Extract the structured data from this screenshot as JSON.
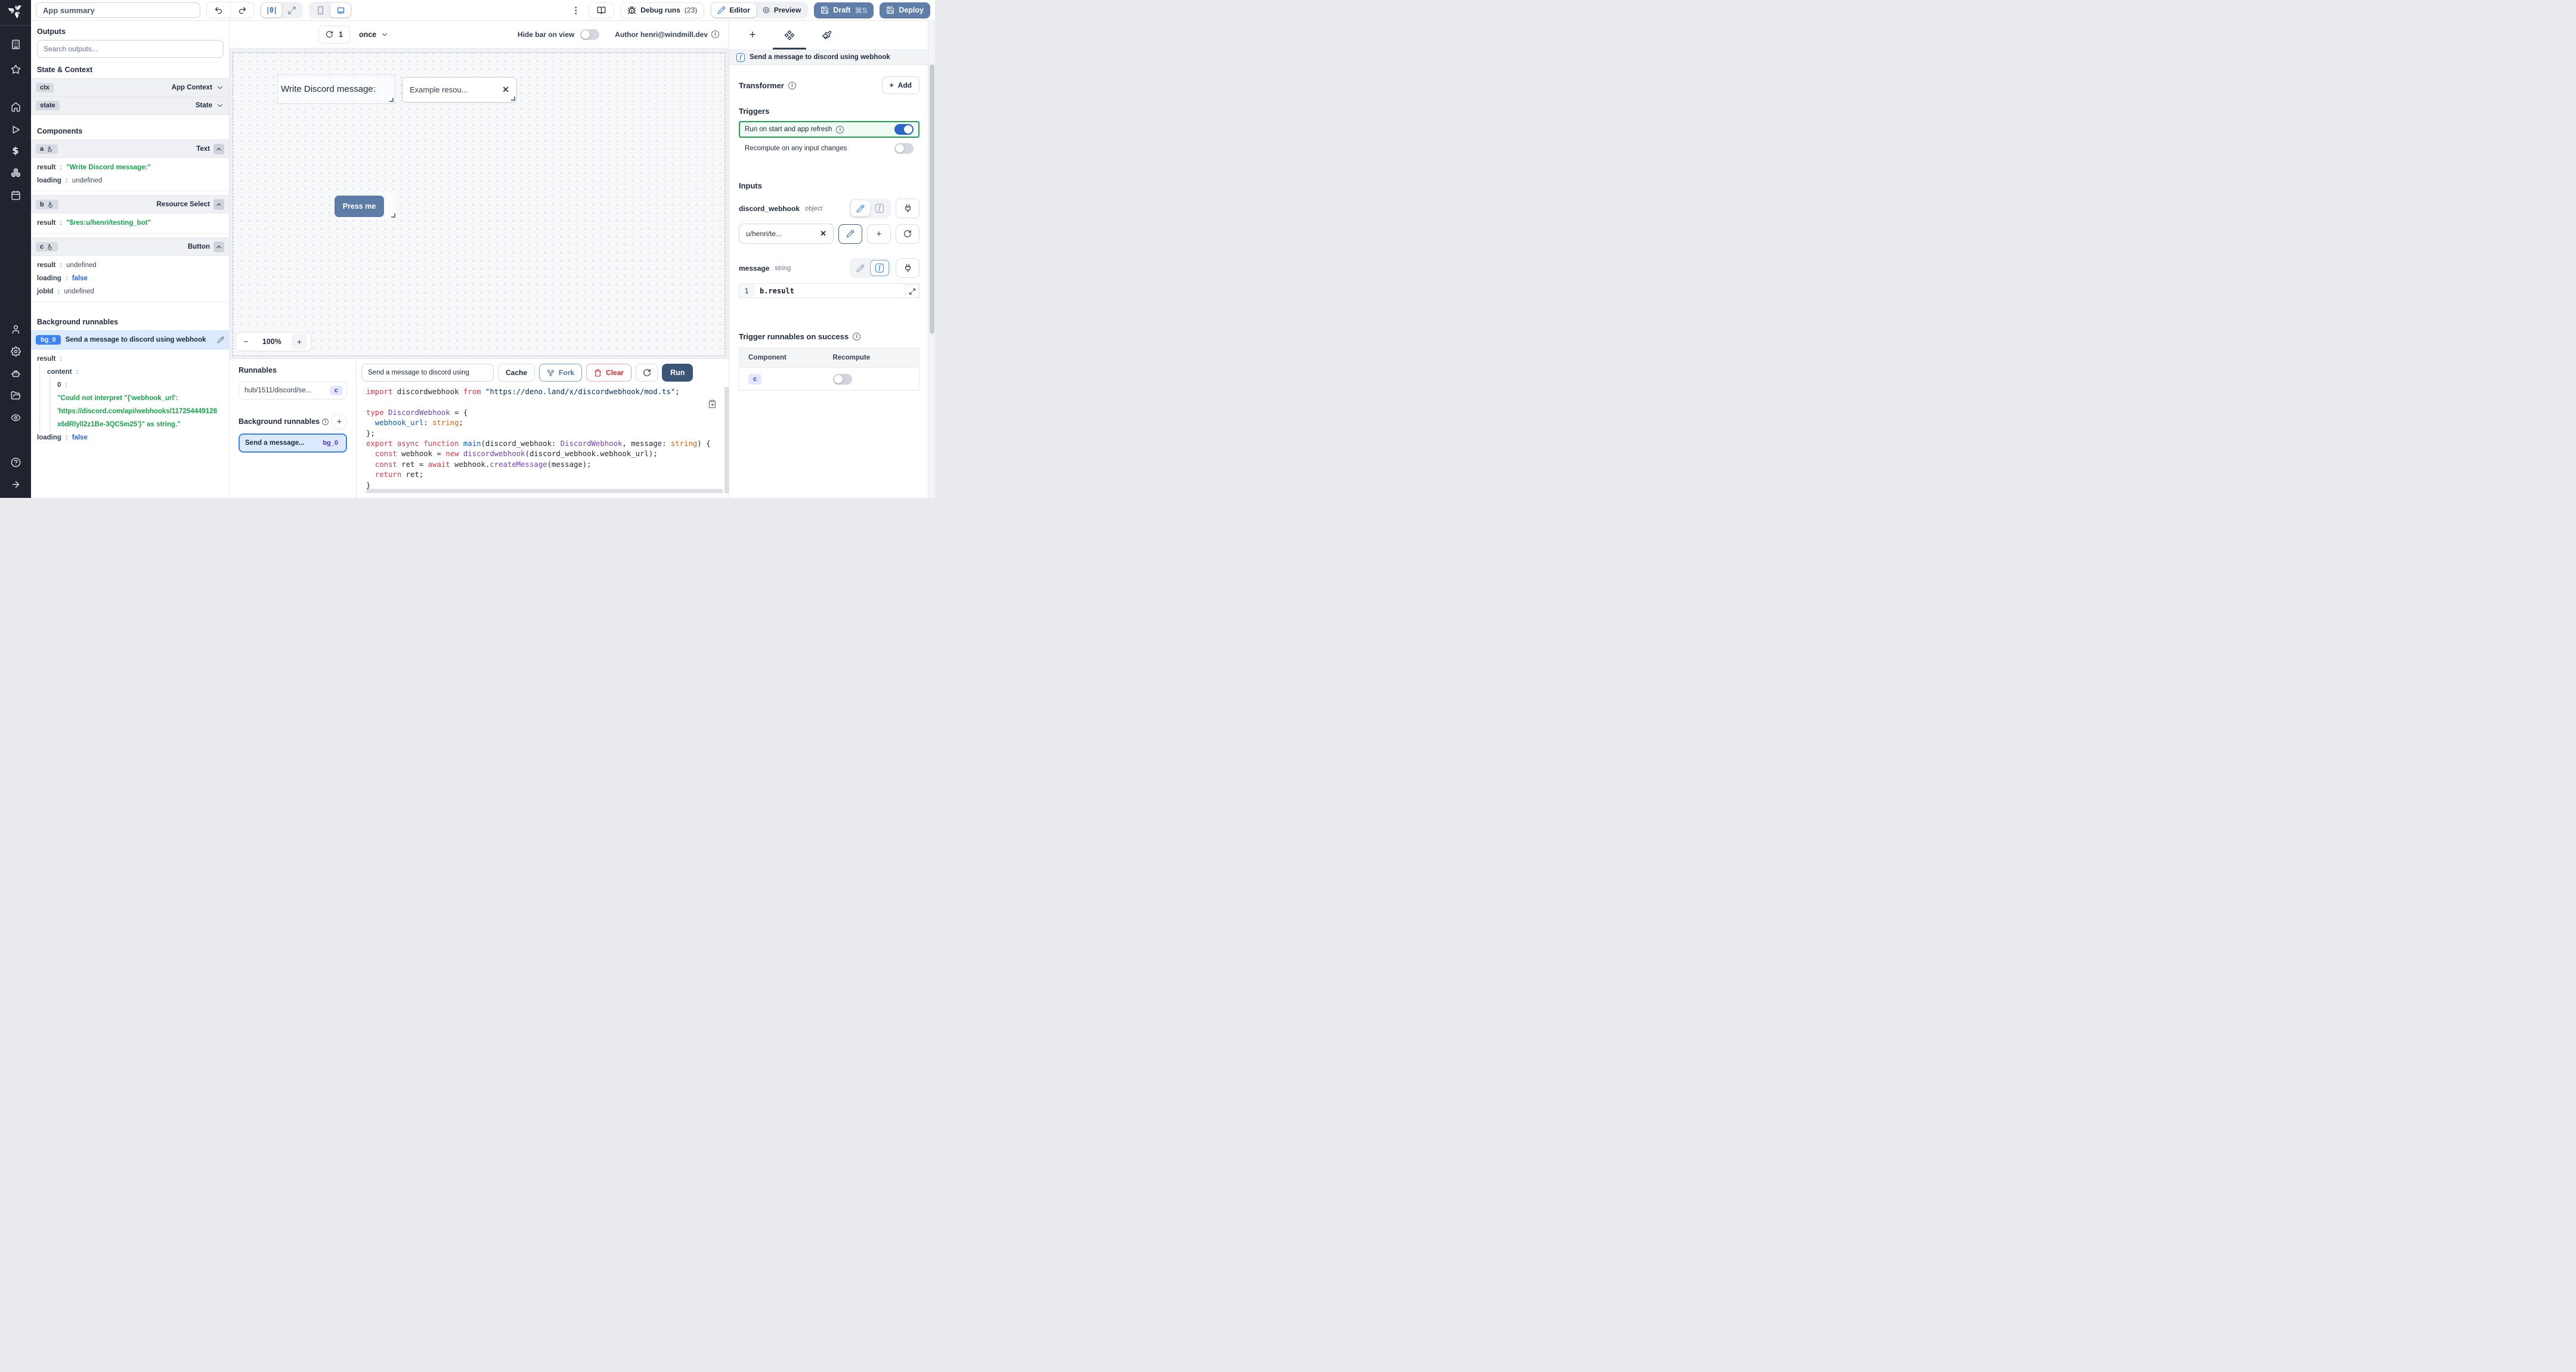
{
  "icons_glyphs": {
    "info": "i",
    "close": "✕",
    "plus": "+",
    "minus": "−",
    "kebab": "⋮",
    "dollar": "$",
    "center_align": "|0|",
    "fn": "f"
  },
  "topbar": {
    "app_summary": "App summary",
    "debug_runs_label": "Debug runs",
    "debug_runs_count": "(23)",
    "editor_label": "Editor",
    "preview_label": "Preview",
    "draft_label": "Draft",
    "draft_shortcut": "⌘S",
    "deploy_label": "Deploy"
  },
  "sidebar": {
    "icon_names": [
      "windmill-logo",
      "building",
      "star",
      "home",
      "play",
      "dollar",
      "boxes",
      "calendar",
      "user",
      "settings",
      "bot",
      "folder-open",
      "eye",
      "help",
      "arrow-right"
    ]
  },
  "outputs_panel": {
    "title": "Outputs",
    "search_placeholder": "Search outputs...",
    "state_context_title": "State & Context",
    "ctx_badge": "ctx",
    "ctx_label": "App Context",
    "state_badge": "state",
    "state_label": "State",
    "components_title": "Components",
    "comp_a": {
      "id": "a",
      "type": "Text",
      "rows": [
        {
          "k": "result",
          "v": "\"Write Discord message:\""
        },
        {
          "k": "loading",
          "v": "undefined"
        }
      ]
    },
    "comp_b": {
      "id": "b",
      "type": "Resource Select",
      "rows": [
        {
          "k": "result",
          "v": "\"$res:u/henri/testing_bot\""
        }
      ]
    },
    "comp_c": {
      "id": "c",
      "type": "Button",
      "rows": [
        {
          "k": "result",
          "v": "undefined"
        },
        {
          "k": "loading",
          "v": "false"
        },
        {
          "k": "jobId",
          "v": "undefined"
        }
      ]
    },
    "background_title": "Background runnables",
    "bg": {
      "badge": "bg_0",
      "name": "Send a message to discord using webhook",
      "result_key": "result",
      "content_key": "content",
      "zero_key": "0",
      "line1": "\"Could not interpret \"{'webhook_url':",
      "line2": "'https://discord.com/api/webhooks/117254449128",
      "line3": "x6dRlyll2z1Be-3QC5m25'}\" as string.\"",
      "loading_key": "loading",
      "loading_val": "false"
    }
  },
  "canvas": {
    "refresh_count": "1",
    "frequency": "once",
    "hide_bar_label": "Hide bar on view",
    "author_label": "Author henri@windmill.dev",
    "zoom_level": "100%",
    "text_component": "Write Discord message:",
    "select_value": "Example resou...",
    "button_label": "Press me"
  },
  "runnables_panel": {
    "title": "Runnables",
    "item_path": "hub/1511/discord/se...",
    "item_badge": "c",
    "bg_title": "Background runnables",
    "bg_item_name": "Send a message...",
    "bg_item_badge": "bg_0"
  },
  "script_editor": {
    "name_field": "Send a message to discord using",
    "cache_label": "Cache",
    "fork_label": "Fork",
    "clear_label": "Clear",
    "run_label": "Run",
    "code_lines": [
      [
        [
          "import ",
          "k"
        ],
        [
          "discordwebhook ",
          "p"
        ],
        [
          "from ",
          "k"
        ],
        [
          "\"https://deno.land/x/discordwebhook/mod.ts\"",
          "s"
        ],
        [
          ";",
          "p"
        ]
      ],
      [],
      [
        [
          "type ",
          "k"
        ],
        [
          "DiscordWebhook",
          "t"
        ],
        [
          " = {",
          "p"
        ]
      ],
      [
        [
          "  webhook_url",
          "b"
        ],
        [
          ": ",
          "p"
        ],
        [
          "string",
          "o"
        ],
        [
          ";",
          "p"
        ]
      ],
      [
        [
          "};",
          "p"
        ]
      ],
      [
        [
          "export ",
          "k"
        ],
        [
          "async ",
          "k"
        ],
        [
          "function ",
          "k"
        ],
        [
          "main",
          "b"
        ],
        [
          "(discord_webhook: ",
          "p"
        ],
        [
          "DiscordWebhook",
          "t"
        ],
        [
          ", message: ",
          "p"
        ],
        [
          "string",
          "o"
        ],
        [
          ") {",
          "p"
        ]
      ],
      [
        [
          "  ",
          "p"
        ],
        [
          "const ",
          "k"
        ],
        [
          "webhook = ",
          "p"
        ],
        [
          "new ",
          "k"
        ],
        [
          "discordwebhook",
          "t"
        ],
        [
          "(discord_webhook.webhook_url);",
          "p"
        ]
      ],
      [
        [
          "  ",
          "p"
        ],
        [
          "const ",
          "k"
        ],
        [
          "ret = ",
          "p"
        ],
        [
          "await ",
          "k"
        ],
        [
          "webhook.",
          "p"
        ],
        [
          "createMessage",
          "t"
        ],
        [
          "(message);",
          "p"
        ]
      ],
      [
        [
          "  ",
          "p"
        ],
        [
          "return ",
          "k"
        ],
        [
          "ret;",
          "p"
        ]
      ],
      [
        [
          "}",
          "p"
        ]
      ]
    ]
  },
  "inspector": {
    "header_title": "Send a message to discord using webhook",
    "transformer_title": "Transformer",
    "add_label": "Add",
    "triggers_title": "Triggers",
    "run_on_start_label": "Run on start and app refresh",
    "recompute_label": "Recompute on any input changes",
    "inputs_title": "Inputs",
    "field1_name": "discord_webhook",
    "field1_type": "object",
    "field1_value": "u/henri/te...",
    "field2_name": "message",
    "field2_type": "string",
    "field2_line": "1",
    "field2_code": "b.result",
    "success_title": "Trigger runnables on success",
    "table_col1": "Component",
    "table_col2": "Recompute",
    "table_row_badge": "c"
  },
  "colors": {
    "accent": "#3b82f6",
    "slate_button": "#5f7ea8",
    "run_button": "#3b5577",
    "success_green": "#1da152",
    "string_green": "#17a34a",
    "bool_blue": "#2563eb"
  }
}
